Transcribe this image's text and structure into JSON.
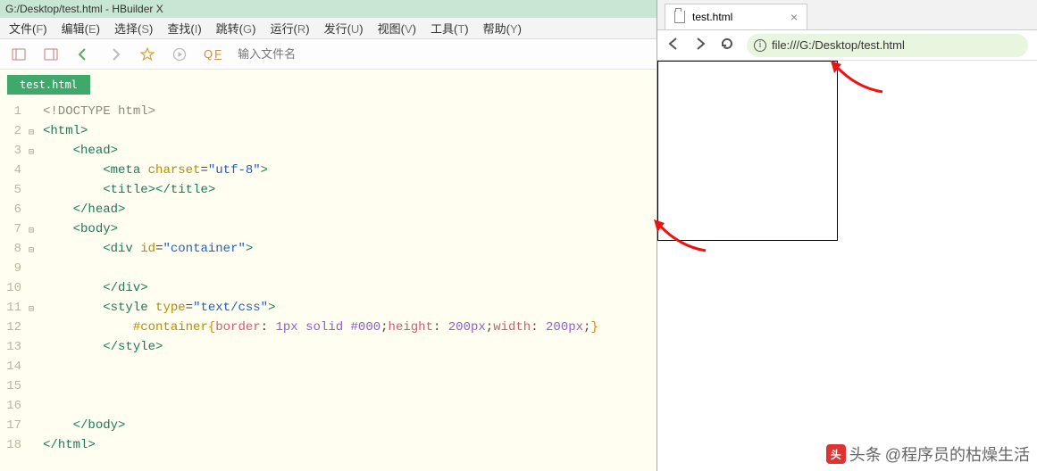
{
  "editor": {
    "titlebar": "G:/Desktop/test.html - HBuilder X",
    "menus": [
      {
        "label": "文件",
        "key": "F"
      },
      {
        "label": "编辑",
        "key": "E"
      },
      {
        "label": "选择",
        "key": "S"
      },
      {
        "label": "查找",
        "key": "I"
      },
      {
        "label": "跳转",
        "key": "G"
      },
      {
        "label": "运行",
        "key": "R"
      },
      {
        "label": "发行",
        "key": "U"
      },
      {
        "label": "视图",
        "key": "V"
      },
      {
        "label": "工具",
        "key": "T"
      },
      {
        "label": "帮助",
        "key": "Y"
      }
    ],
    "toolbar": {
      "search_label": "Q",
      "search_sub": "F",
      "path_placeholder": "输入文件名"
    },
    "tab_name": "test.html",
    "code": {
      "l1": "<!DOCTYPE html>",
      "l2a": "<",
      "l2b": "html",
      "l2c": ">",
      "l3a": "<",
      "l3b": "head",
      "l3c": ">",
      "l4a": "<",
      "l4b": "meta",
      "l4c": " ",
      "l4d": "charset",
      "l4e": "=",
      "l4f": "\"utf-8\"",
      "l4g": ">",
      "l5a": "<",
      "l5b": "title",
      "l5c": "></",
      "l5d": "title",
      "l5e": ">",
      "l6a": "</",
      "l6b": "head",
      "l6c": ">",
      "l7a": "<",
      "l7b": "body",
      "l7c": ">",
      "l8a": "<",
      "l8b": "div",
      "l8c": " ",
      "l8d": "id",
      "l8e": "=",
      "l8f": "\"container\"",
      "l8g": ">",
      "l10a": "</",
      "l10b": "div",
      "l10c": ">",
      "l11a": "<",
      "l11b": "style",
      "l11c": " ",
      "l11d": "type",
      "l11e": "=",
      "l11f": "\"text/css\"",
      "l11g": ">",
      "l12a": "#container",
      "l12b": "{",
      "l12c": "border",
      "l12d": ": ",
      "l12e": "1px",
      "l12f": " ",
      "l12g": "solid",
      "l12h": " ",
      "l12i": "#000",
      "l12j": ";",
      "l12k": "height",
      "l12l": ": ",
      "l12m": "200px",
      "l12n": ";",
      "l12o": "width",
      "l12p": ": ",
      "l12q": "200px",
      "l12r": ";",
      "l12s": "}",
      "l13a": "</",
      "l13b": "style",
      "l13c": ">",
      "l17a": "</",
      "l17b": "body",
      "l17c": ">",
      "l18a": "</",
      "l18b": "html",
      "l18c": ">"
    }
  },
  "browser": {
    "tab_title": "test.html",
    "url": "file:///G:/Desktop/test.html"
  },
  "watermark": {
    "prefix": "头条",
    "handle": "@程序员的枯燥生活"
  }
}
